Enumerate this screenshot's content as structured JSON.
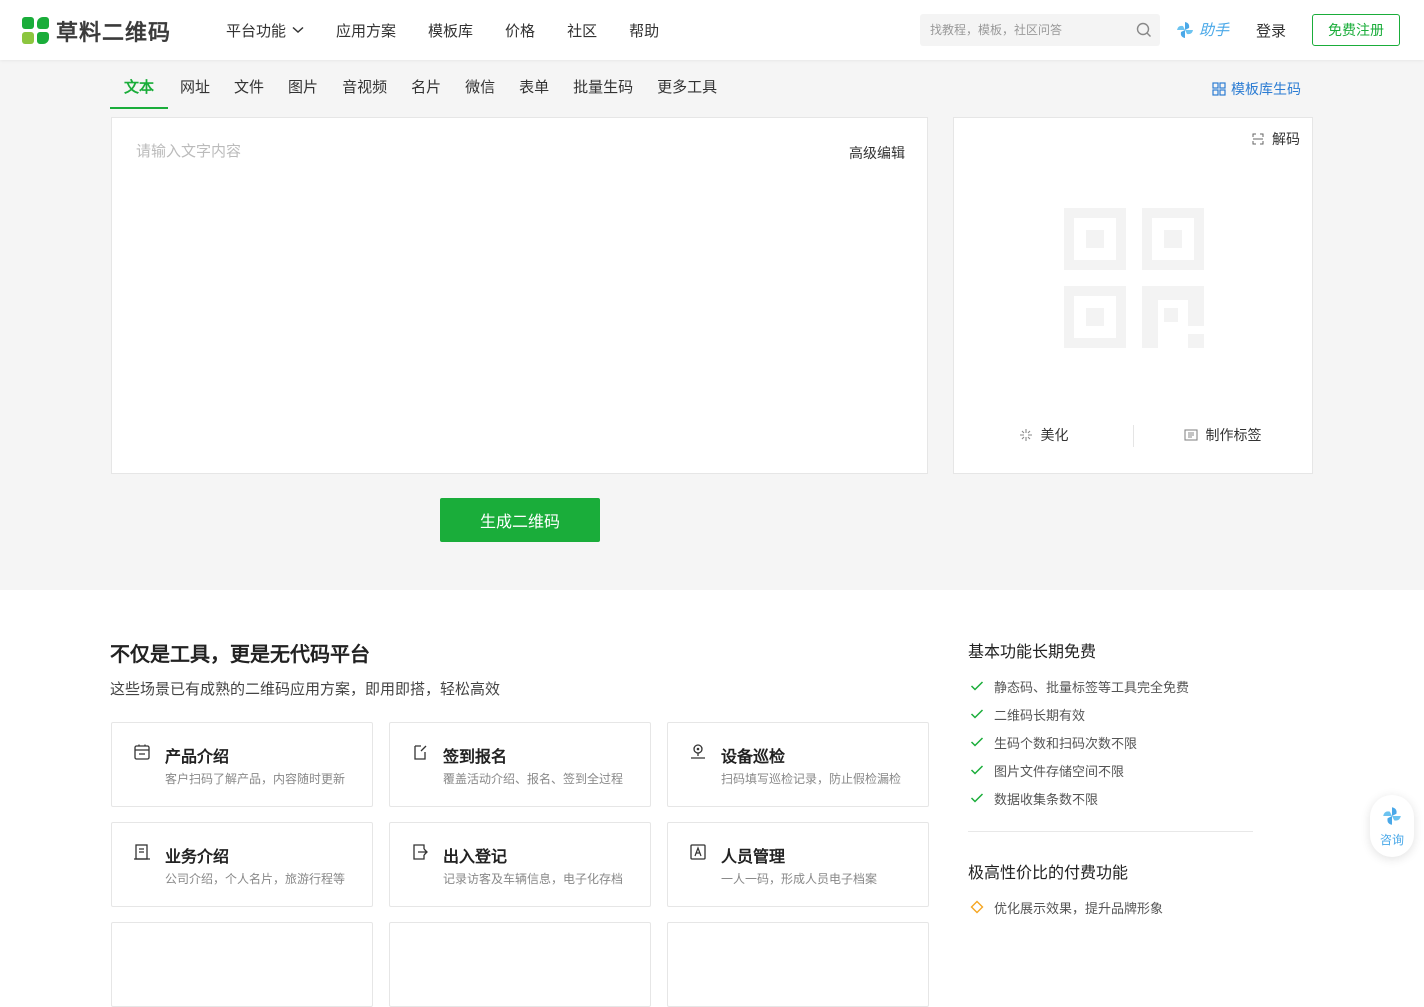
{
  "header": {
    "logo_text": "草料二维码",
    "nav": [
      {
        "label": "平台功能",
        "has_dropdown": true
      },
      {
        "label": "应用方案"
      },
      {
        "label": "模板库"
      },
      {
        "label": "价格"
      },
      {
        "label": "社区"
      },
      {
        "label": "帮助"
      }
    ],
    "search_placeholder": "找教程，模板，社区问答",
    "helper_label": "助手",
    "login_label": "登录",
    "register_label": "免费注册"
  },
  "tabs": {
    "items": [
      "文本",
      "网址",
      "文件",
      "图片",
      "音视频",
      "名片",
      "微信",
      "表单",
      "批量生码",
      "更多工具"
    ],
    "active": "文本",
    "template_link": "模板库生码"
  },
  "editor": {
    "placeholder": "请输入文字内容",
    "advanced_label": "高级编辑"
  },
  "preview": {
    "decode_label": "解码",
    "beautify_label": "美化",
    "label_label": "制作标签"
  },
  "generate_label": "生成二维码",
  "platform": {
    "title": "不仅是工具，更是无代码平台",
    "subtitle": "这些场景已有成熟的二维码应用方案，即用即搭，轻松高效",
    "cards": [
      {
        "icon": "product-icon",
        "title": "产品介绍",
        "desc": "客户扫码了解产品，内容随时更新"
      },
      {
        "icon": "signup-icon",
        "title": "签到报名",
        "desc": "覆盖活动介绍、报名、签到全过程"
      },
      {
        "icon": "inspection-icon",
        "title": "设备巡检",
        "desc": "扫码填写巡检记录，防止假检漏检"
      },
      {
        "icon": "business-icon",
        "title": "业务介绍",
        "desc": "公司介绍，个人名片，旅游行程等"
      },
      {
        "icon": "access-icon",
        "title": "出入登记",
        "desc": "记录访客及车辆信息，电子化存档"
      },
      {
        "icon": "personnel-icon",
        "title": "人员管理",
        "desc": "一人一码，形成人员电子档案"
      }
    ]
  },
  "free_features": {
    "title": "基本功能长期免费",
    "items": [
      "静态码、批量标签等工具完全免费",
      "二维码长期有效",
      "生码个数和扫码次数不限",
      "图片文件存储空间不限",
      "数据收集条数不限"
    ]
  },
  "paid_features": {
    "title": "极高性价比的付费功能",
    "items": [
      "优化展示效果，提升品牌形象"
    ]
  },
  "consult_label": "咨询",
  "colors": {
    "brand_green": "#1aad3a",
    "link_blue": "#2b7cd3",
    "helper_blue": "#4aa8e8",
    "paid_orange": "#f5a623"
  }
}
